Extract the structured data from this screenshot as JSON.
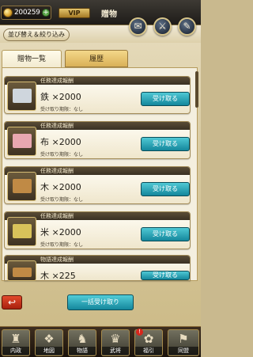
{
  "header": {
    "coin_amount": "200259",
    "coin_plus": "+",
    "vip_label": "VIP",
    "title": "贈物"
  },
  "toolbar": {
    "sort_filter_label": "並び替え＆絞り込み",
    "round_buttons": [
      {
        "icon": "gift-box-icon",
        "glyph": "✉"
      },
      {
        "icon": "crossed-swords-icon",
        "glyph": "⚔"
      },
      {
        "icon": "quill-icon",
        "glyph": "✎"
      }
    ]
  },
  "tabs": [
    {
      "label": "贈物一覧",
      "active": true
    },
    {
      "label": "履歴",
      "active": false
    }
  ],
  "gifts": [
    {
      "category": "任務達成報酬",
      "name": "鉄 ×2000",
      "deadline": "受け取り期限：なし",
      "button": "受け取る",
      "thumb_color": "#cfd6dd"
    },
    {
      "category": "任務達成報酬",
      "name": "布 ×2000",
      "deadline": "受け取り期限：なし",
      "button": "受け取る",
      "thumb_color": "#e8a7b0"
    },
    {
      "category": "任務達成報酬",
      "name": "木 ×2000",
      "deadline": "受け取り期限：なし",
      "button": "受け取る",
      "thumb_color": "#c08a45"
    },
    {
      "category": "任務達成報酬",
      "name": "米 ×2000",
      "deadline": "受け取り期限：なし",
      "button": "受け取る",
      "thumb_color": "#d8c25a"
    },
    {
      "category": "物語達成報酬",
      "name": "木 ×225",
      "deadline": "受け取り期限：なし",
      "button": "受け取る",
      "thumb_color": "#c08a45"
    }
  ],
  "bottom": {
    "back_glyph": "↩",
    "bulk_receive_label": "一括受け取り"
  },
  "nav": [
    {
      "label": "内政",
      "glyph": "♜"
    },
    {
      "label": "地図",
      "glyph": "❖"
    },
    {
      "label": "物語",
      "glyph": "♞"
    },
    {
      "label": "武将",
      "glyph": "♛"
    },
    {
      "label": "福引",
      "glyph": "✿",
      "badge": "!"
    },
    {
      "label": "同盟",
      "glyph": "⚑"
    }
  ]
}
